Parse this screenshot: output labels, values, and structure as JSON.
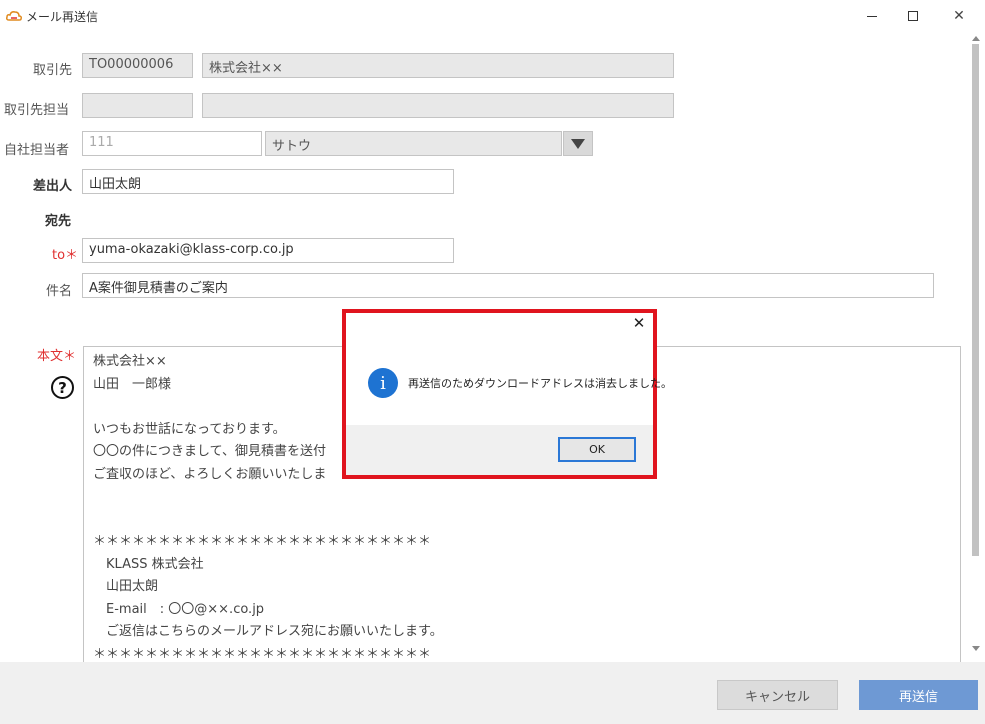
{
  "window": {
    "title": "メール再送信",
    "close_glyph": "✕"
  },
  "form": {
    "client_label": "取引先",
    "client_code": "TO00000006",
    "client_name": "株式会社××",
    "client_contact_label": "取引先担当",
    "client_contact_code": "",
    "client_contact_name": "",
    "staff_label": "自社担当者",
    "staff_code": "111",
    "staff_name": "サトウ",
    "sender_label": "差出人",
    "sender_value": "山田太朗",
    "recipient_label": "宛先",
    "to_label": "to＊",
    "to_value": "yuma-okazaki@klass-corp.co.jp",
    "subject_label": "件名",
    "subject_value": "A案件御見積書のご案内",
    "body_label": "本文＊",
    "help_glyph": "?",
    "body_lines": [
      "株式会社××",
      "山田　一郎様",
      "",
      "いつもお世話になっております。",
      "〇〇の件につきまして、御見積書を送付",
      "ご査収のほど、よろしくお願いいたしま",
      "",
      "",
      "＊＊＊＊＊＊＊＊＊＊＊＊＊＊＊＊＊＊＊＊＊＊＊＊＊＊",
      "　KLASS 株式会社",
      "　山田太朗",
      "　E-mail　: 〇〇@××.co.jp",
      "　ご返信はこちらのメールアドレス宛にお願いいたします。",
      "＊＊＊＊＊＊＊＊＊＊＊＊＊＊＊＊＊＊＊＊＊＊＊＊＊＊"
    ]
  },
  "footer": {
    "cancel_label": "キャンセル",
    "resend_label": "再送信"
  },
  "dialog": {
    "info_glyph": "i",
    "message": "再送信のためダウンロードアドレスは消去しました。",
    "ok_label": "OK",
    "close_glyph": "✕",
    "highlight_color": "#e0141e"
  }
}
